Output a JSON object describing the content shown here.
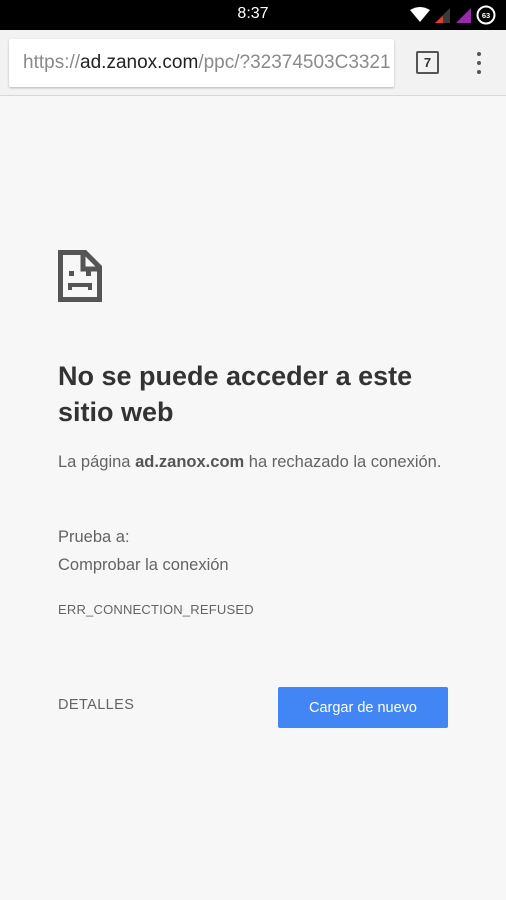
{
  "status_bar": {
    "time": "8:37",
    "battery_level": "63",
    "icons": [
      "wifi-icon",
      "signal-icon",
      "signal-icon",
      "battery-icon"
    ]
  },
  "browser": {
    "url_scheme": "https://",
    "url_host": "ad.zanox.com",
    "url_path": "/ppc/?32374503C3321",
    "tab_count": "7",
    "menu_icon": "more-vert-icon"
  },
  "error_page": {
    "icon": "sad-file-icon",
    "heading": "No se puede acceder a este sitio web",
    "description_prefix": "La página ",
    "description_host": "ad.zanox.com",
    "description_suffix": " ha rechazado la conexión.",
    "suggestions_title": "Prueba a:",
    "suggestions": [
      "Comprobar la conexión"
    ],
    "error_code": "ERR_CONNECTION_REFUSED",
    "details_label": "DETALLES",
    "reload_label": "Cargar de nuevo"
  },
  "colors": {
    "accent": "#4285f4",
    "background": "#f7f7f7",
    "text_primary": "#333333",
    "text_secondary": "#646464"
  }
}
